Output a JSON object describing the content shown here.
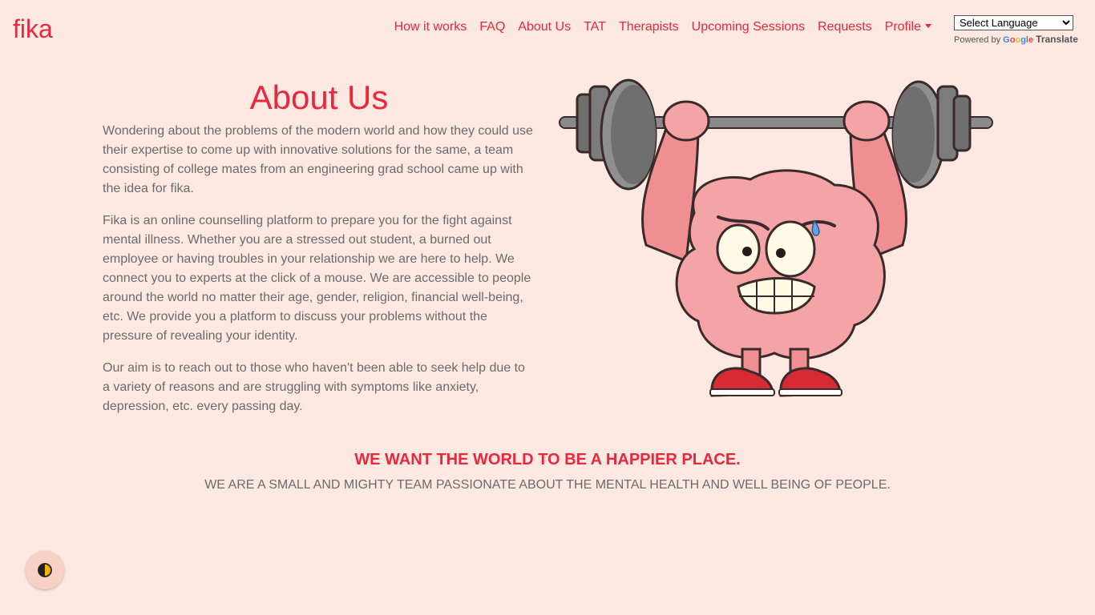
{
  "brand": "fika",
  "nav": {
    "items": [
      {
        "label": "How it works"
      },
      {
        "label": "FAQ"
      },
      {
        "label": "About Us"
      },
      {
        "label": "TAT"
      },
      {
        "label": "Therapists"
      },
      {
        "label": "Upcoming Sessions"
      },
      {
        "label": "Requests"
      },
      {
        "label": "Profile"
      }
    ]
  },
  "translate": {
    "select_value": "Select Language",
    "powered_by": "Powered by",
    "google": "Google",
    "translate": "Translate"
  },
  "main": {
    "title": "About Us",
    "paragraphs": [
      "Wondering about the problems of the modern world and how they could use their expertise to come up with innovative solutions for the same, a team consisting of college mates from an engineering grad school came up with the idea for fika.",
      "Fika is an online counselling platform to prepare you for the fight against mental illness. Whether you are a stressed out student, a burned out employee or having troubles in your relationship we are here to help. We connect you to experts at the click of a mouse. We are accessible to people around the world no matter their age, gender, religion, financial well-being, etc. We provide you a platform to discuss your problems without the pressure of revealing your identity.",
      "Our aim is to reach out to those who haven't been able to seek help due to a variety of reasons and are struggling with symptoms like anxiety, depression, etc. every passing day."
    ],
    "illustration_icon": "brain-lifting-barbell-illustration"
  },
  "tagline": "WE WANT THE WORLD TO BE A HAPPIER PLACE.",
  "subtagline": "WE ARE A SMALL AND MIGHTY TEAM PASSIONATE ABOUT THE MENTAL HEALTH AND WELL BEING OF PEOPLE.",
  "accessibility_icon": "contrast-toggle-icon",
  "colors": {
    "background": "#fde8e2",
    "accent": "#e8283c",
    "text": "#6b6b6b"
  }
}
